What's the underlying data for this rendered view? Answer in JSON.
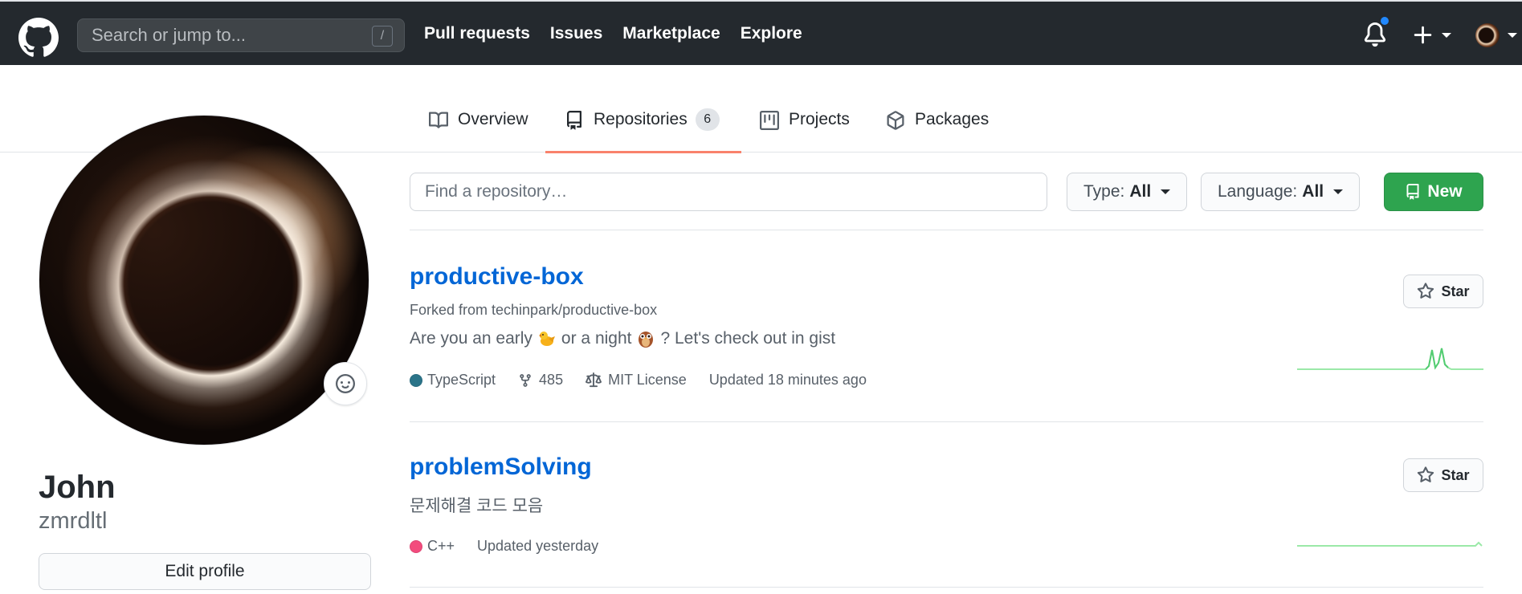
{
  "header": {
    "search_placeholder": "Search or jump to...",
    "search_shortcut": "/",
    "nav": [
      "Pull requests",
      "Issues",
      "Marketplace",
      "Explore"
    ]
  },
  "tabs": [
    {
      "label": "Overview",
      "icon": "book-icon"
    },
    {
      "label": "Repositories",
      "count": "6",
      "icon": "repo-icon",
      "active": true
    },
    {
      "label": "Projects",
      "icon": "project-icon"
    },
    {
      "label": "Packages",
      "icon": "package-icon"
    }
  ],
  "profile": {
    "name": "John",
    "login": "zmrdltl",
    "edit_label": "Edit profile"
  },
  "filters": {
    "find_placeholder": "Find a repository…",
    "type_label": "Type:",
    "type_value": "All",
    "language_label": "Language:",
    "language_value": "All",
    "new_label": "New"
  },
  "repos": [
    {
      "name": "productive-box",
      "forked_from": "Forked from techinpark/productive-box",
      "desc_parts": [
        "Are you an early",
        "or a night",
        "? Let's check out in gist"
      ],
      "language": "TypeScript",
      "language_color": "#2b7489",
      "forks": "485",
      "license": "MIT License",
      "updated": "Updated 18 minutes ago",
      "star_label": "Star"
    },
    {
      "name": "problemSolving",
      "desc": "문제해결 코드 모음",
      "language": "C++",
      "language_color": "#f34b7d",
      "updated": "Updated yesterday",
      "star_label": "Star"
    }
  ],
  "colors": {
    "header_bg": "#24292e",
    "link_blue": "#0366d6",
    "new_green": "#2ea44f",
    "tab_underline": "#f9826c"
  }
}
